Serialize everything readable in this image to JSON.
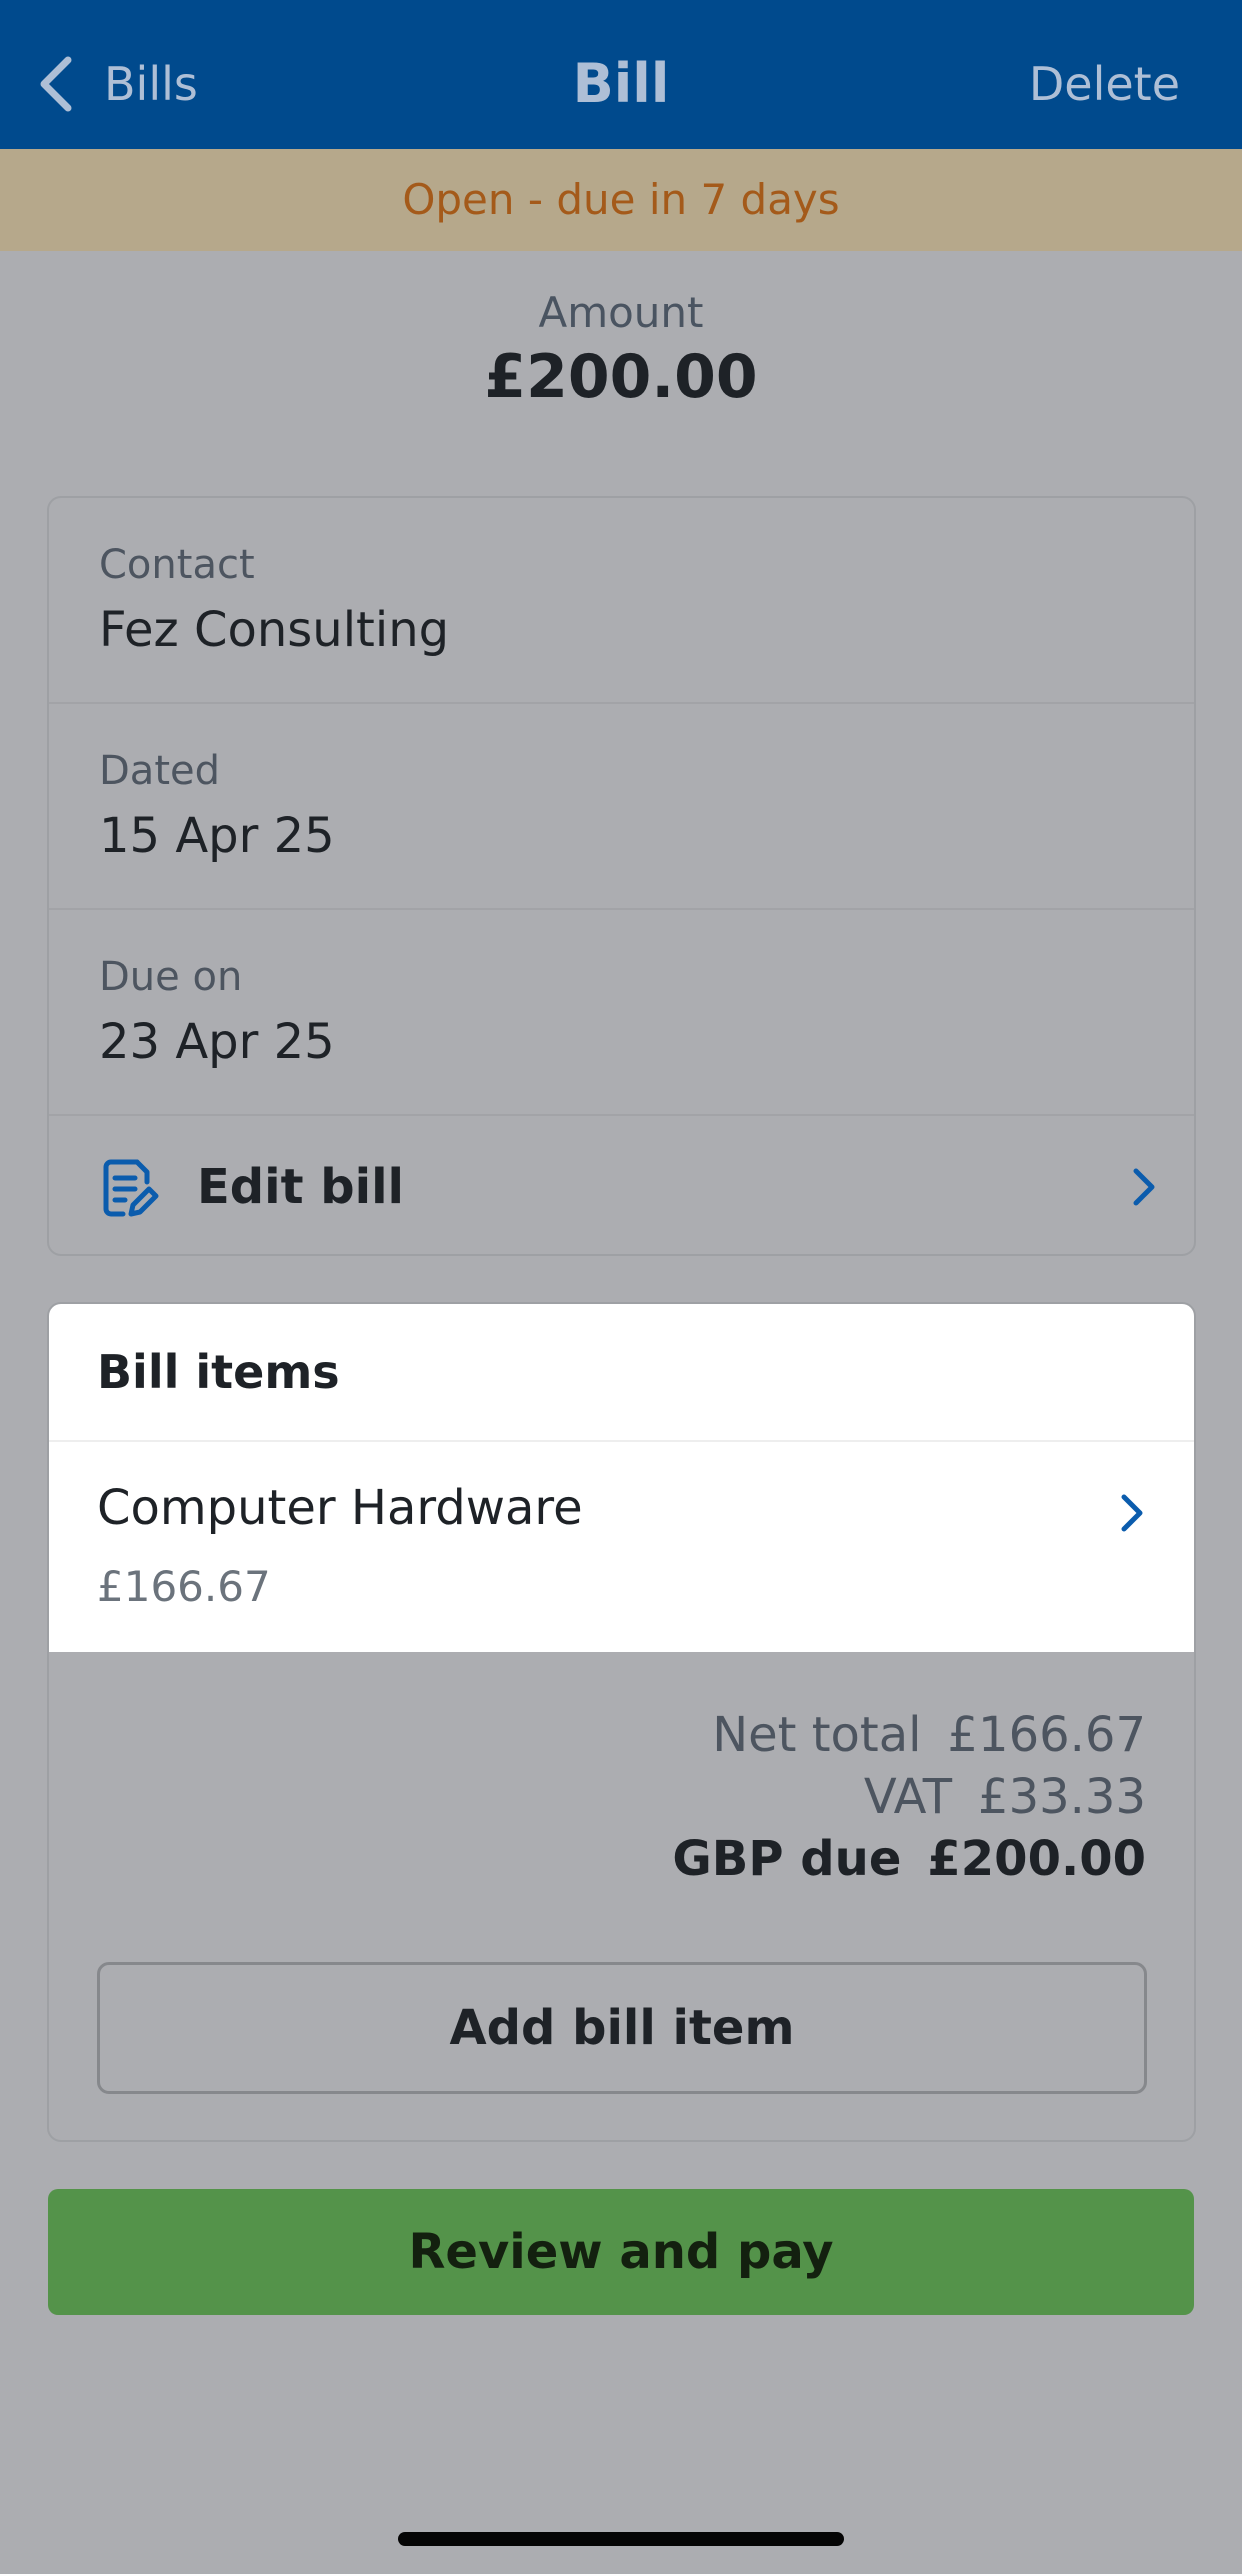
{
  "nav": {
    "back_label": "Bills",
    "title": "Bill",
    "delete_label": "Delete"
  },
  "status": {
    "text": "Open - due in 7 days"
  },
  "amount": {
    "label": "Amount",
    "value": "£200.00"
  },
  "details": {
    "contact": {
      "label": "Contact",
      "value": "Fez Consulting"
    },
    "dated": {
      "label": "Dated",
      "value": "15 Apr 25"
    },
    "due_on": {
      "label": "Due on",
      "value": "23 Apr 25"
    },
    "edit_label": "Edit bill"
  },
  "items": {
    "header": "Bill items",
    "list": [
      {
        "name": "Computer Hardware",
        "amount": "£166.67"
      }
    ]
  },
  "totals": {
    "net_label": "Net total",
    "net_value": "£166.67",
    "vat_label": "VAT",
    "vat_value": "£33.33",
    "due_label": "GBP due",
    "due_value": "£200.00"
  },
  "actions": {
    "add_item_label": "Add bill item",
    "pay_label": "Review and pay"
  },
  "icons": {
    "back": "chevron-left-icon",
    "edit": "document-edit-icon",
    "row_chevron": "chevron-right-icon"
  },
  "colors": {
    "nav_bg": "#004a8d",
    "status_bg": "#b6a88b",
    "status_text": "#a45a1a",
    "accent_blue": "#0b5cad",
    "pay_green": "#54934a"
  }
}
